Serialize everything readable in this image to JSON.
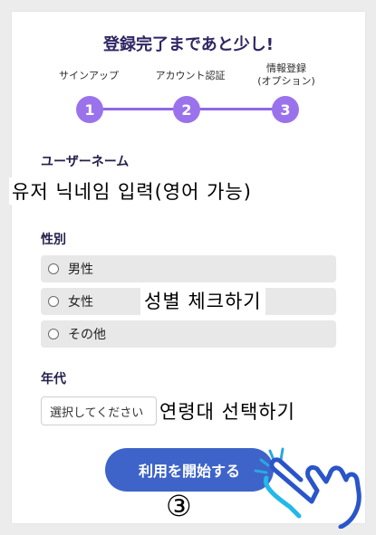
{
  "title": "登録完了まであと少し!",
  "steps": [
    {
      "label": "サインアップ",
      "number": "1"
    },
    {
      "label": "アカウント認証",
      "number": "2"
    },
    {
      "label_line1": "情報登録",
      "label_line2": "(オプション)",
      "number": "3"
    }
  ],
  "username": {
    "label": "ユーザーネーム",
    "annotation": "유저 닉네임 입력(영어 가능)"
  },
  "gender": {
    "label": "性別",
    "options": [
      "男性",
      "女性",
      "その他"
    ],
    "annotation": "성별 체크하기"
  },
  "age": {
    "label": "年代",
    "placeholder": "選択してください",
    "annotation": "연령대 선택하기"
  },
  "start_button": {
    "label": "利用を開始する"
  },
  "step_marker": "③",
  "colors": {
    "accent": "#9a73ec",
    "button": "#3e64c9",
    "title": "#2f2563"
  },
  "icons": [
    "pointing-hand-icon"
  ]
}
